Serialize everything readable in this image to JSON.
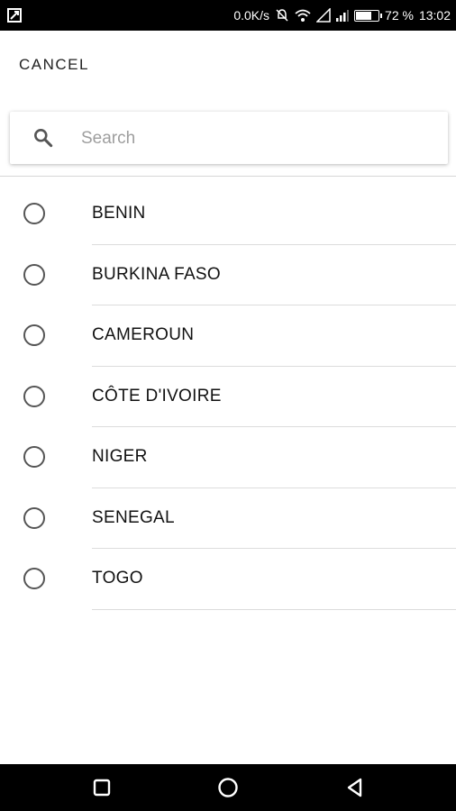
{
  "status_bar": {
    "net_speed": "0.0K/s",
    "battery_percent": "72 %",
    "battery_level": 0.72,
    "time": "13:02"
  },
  "header": {
    "cancel_label": "CANCEL"
  },
  "search": {
    "placeholder": "Search",
    "value": ""
  },
  "countries": [
    {
      "label": "BENIN",
      "selected": false
    },
    {
      "label": "BURKINA FASO",
      "selected": false
    },
    {
      "label": "CAMEROUN",
      "selected": false
    },
    {
      "label": "CÔTE D'IVOIRE",
      "selected": false
    },
    {
      "label": "NIGER",
      "selected": false
    },
    {
      "label": "SENEGAL",
      "selected": false
    },
    {
      "label": "TOGO",
      "selected": false
    }
  ],
  "icons": {
    "search": "search-icon",
    "nav_recent": "square-icon",
    "nav_home": "circle-icon",
    "nav_back": "triangle-back-icon"
  }
}
